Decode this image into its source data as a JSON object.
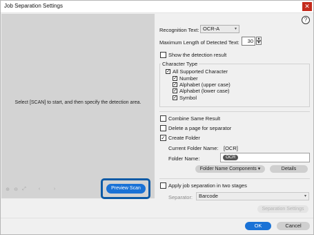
{
  "window": {
    "title": "Job Separation Settings",
    "close_glyph": "✕",
    "help_glyph": "?"
  },
  "preview": {
    "message": "Select [SCAN] to start, and then specify the detection area.",
    "tools": [
      "zoom-in-icon",
      "zoom-out-icon",
      "fit-icon",
      "prev-icon",
      "next-icon"
    ],
    "tool_glyphs": [
      "⊕",
      "⊖",
      "⤢",
      "‹",
      "›"
    ],
    "preview_scan_label": "Preview Scan"
  },
  "settings": {
    "recognition_text_label": "Recognition Text:",
    "recognition_text_value": "OCR-A",
    "max_length_label": "Maximum Length of Detected Text:",
    "max_length_value": "30",
    "show_detection_result_label": "Show the detection result",
    "show_detection_result_checked": false,
    "character_type": {
      "legend": "Character Type",
      "all_label": "All Supported Character",
      "all_checked": true,
      "items": [
        {
          "label": "Number",
          "checked": true
        },
        {
          "label": "Alphabet (upper case)",
          "checked": true
        },
        {
          "label": "Alphabet (lower case)",
          "checked": true
        },
        {
          "label": "Symbol",
          "checked": true
        }
      ]
    },
    "combine_same_result_label": "Combine Same Result",
    "combine_same_result_checked": false,
    "delete_page_label": "Delete a page for separator",
    "delete_page_checked": false,
    "create_folder_label": "Create Folder",
    "create_folder_checked": true,
    "current_folder_name_label": "Current Folder Name:",
    "current_folder_name_value": "[OCR]",
    "folder_name_label": "Folder Name:",
    "folder_name_chip": "OCR",
    "folder_name_components_label": "Folder Name Components ▾",
    "details_label": "Details",
    "apply_two_stages_label": "Apply job separation in two stages",
    "apply_two_stages_checked": false,
    "separator_label": "Separator:",
    "separator_value": "Barcode",
    "separation_settings_label": "Separation Settings"
  },
  "footer": {
    "ok_label": "OK",
    "cancel_label": "Cancel"
  },
  "colors": {
    "accent": "#1a72d6",
    "highlight_border": "#0c5aa6",
    "close": "#c42b1c"
  }
}
